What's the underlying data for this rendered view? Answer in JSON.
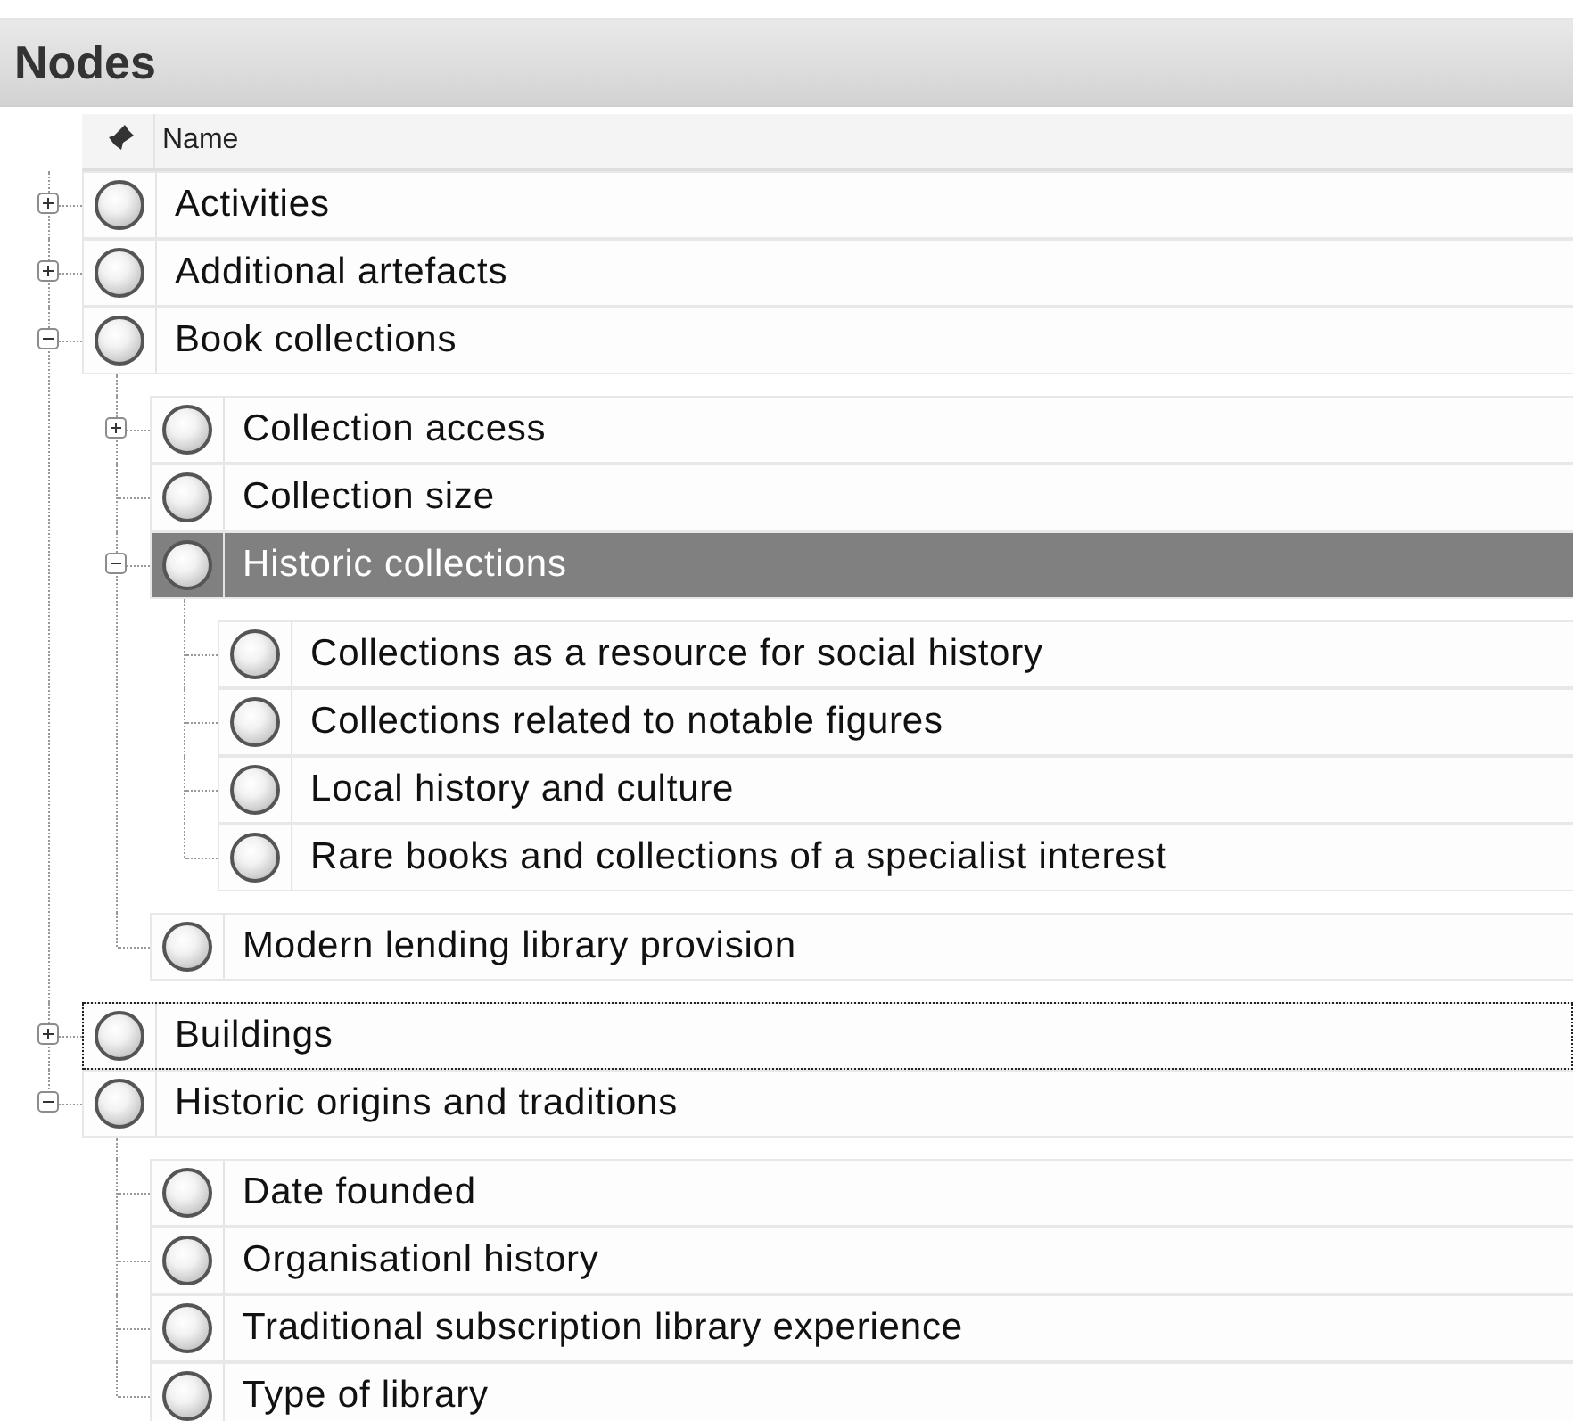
{
  "panel": {
    "title": "Nodes"
  },
  "columns": [
    {
      "label": "Name"
    }
  ],
  "nodes": [
    {
      "label": "Activities",
      "expanded": false,
      "selected": false,
      "focused": false
    },
    {
      "label": "Additional artefacts",
      "expanded": false,
      "selected": false,
      "focused": false
    },
    {
      "label": "Book collections",
      "expanded": true,
      "selected": false,
      "focused": false,
      "children": [
        {
          "label": "Collection access",
          "expanded": false,
          "selected": false,
          "focused": false
        },
        {
          "label": "Collection size",
          "selected": false,
          "focused": false
        },
        {
          "label": "Historic collections",
          "expanded": true,
          "selected": true,
          "focused": false,
          "children": [
            {
              "label": "Collections as a resource for social history",
              "selected": false,
              "focused": false
            },
            {
              "label": "Collections related to notable figures",
              "selected": false,
              "focused": false
            },
            {
              "label": "Local history and culture",
              "selected": false,
              "focused": false
            },
            {
              "label": "Rare books and collections of a specialist interest",
              "selected": false,
              "focused": false
            }
          ]
        },
        {
          "label": "Modern lending library provision",
          "selected": false,
          "focused": false
        }
      ]
    },
    {
      "label": "Buildings",
      "expanded": false,
      "selected": false,
      "focused": true
    },
    {
      "label": "Historic origins and traditions",
      "expanded": true,
      "selected": false,
      "focused": false,
      "children": [
        {
          "label": "Date founded",
          "selected": false,
          "focused": false
        },
        {
          "label": "Organisationl history",
          "selected": false,
          "focused": false
        },
        {
          "label": "Traditional subscription library experience",
          "selected": false,
          "focused": false
        },
        {
          "label": "Type of library",
          "selected": false,
          "focused": false
        }
      ]
    }
  ]
}
